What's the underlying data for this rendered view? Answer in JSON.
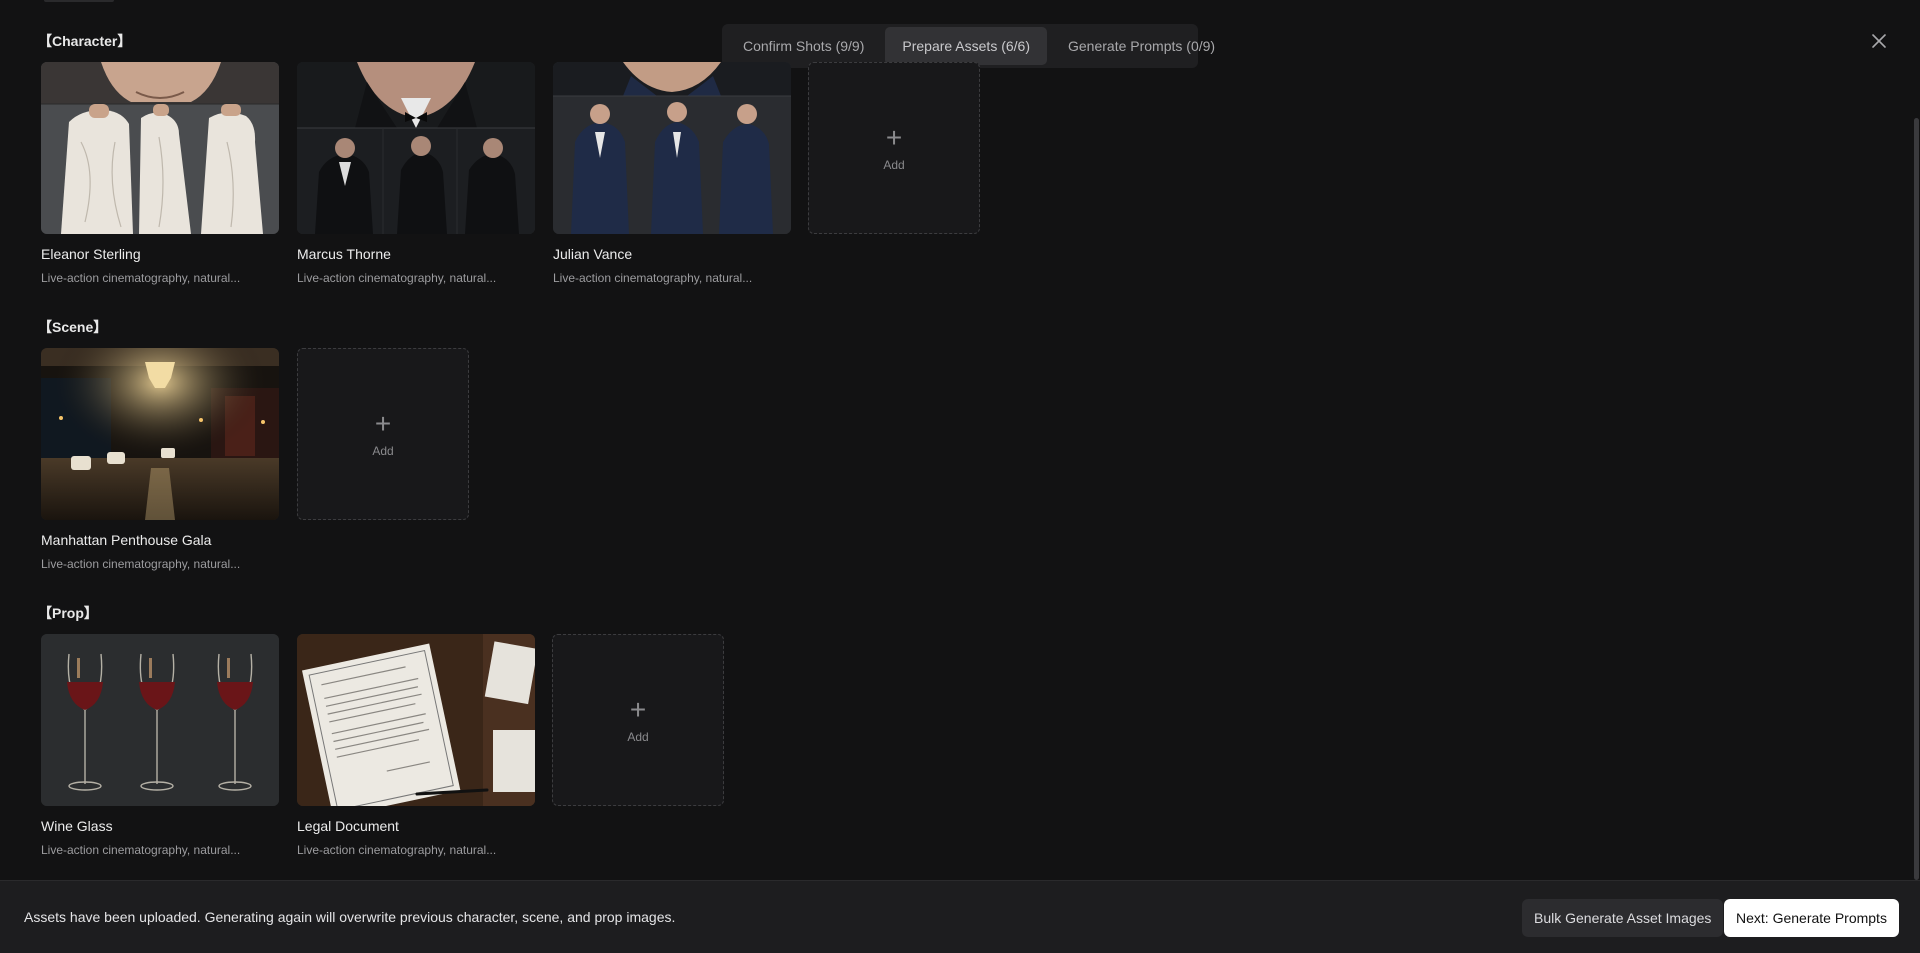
{
  "stepper": {
    "steps": [
      {
        "label": "Confirm Shots (9/9)",
        "active": false
      },
      {
        "label": "Prepare Assets (6/6)",
        "active": true
      },
      {
        "label": "Generate Prompts (0/9)",
        "active": false
      }
    ]
  },
  "sections": {
    "character": {
      "title": "【Character】",
      "items": [
        {
          "name": "Eleanor Sterling",
          "desc": "Live-action cinematography, natural..."
        },
        {
          "name": "Marcus Thorne",
          "desc": "Live-action cinematography, natural..."
        },
        {
          "name": "Julian Vance",
          "desc": "Live-action cinematography, natural..."
        }
      ],
      "add_label": "Add"
    },
    "scene": {
      "title": "【Scene】",
      "items": [
        {
          "name": "Manhattan Penthouse Gala",
          "desc": "Live-action cinematography, natural..."
        }
      ],
      "add_label": "Add"
    },
    "prop": {
      "title": "【Prop】",
      "items": [
        {
          "name": "Wine Glass",
          "desc": "Live-action cinematography, natural..."
        },
        {
          "name": "Legal Document",
          "desc": "Live-action cinematography, natural..."
        }
      ],
      "add_label": "Add"
    }
  },
  "footer": {
    "message": "Assets have been uploaded. Generating again will overwrite previous character, scene, and prop images.",
    "bulk_label": "Bulk Generate Asset Images",
    "next_label": "Next: Generate Prompts"
  },
  "colors": {
    "background": "#121213",
    "footer_bg": "#1d1d1f",
    "stepper_bg": "#1f1f21",
    "stepper_active": "#323235",
    "primary_button": "#ffffff"
  }
}
